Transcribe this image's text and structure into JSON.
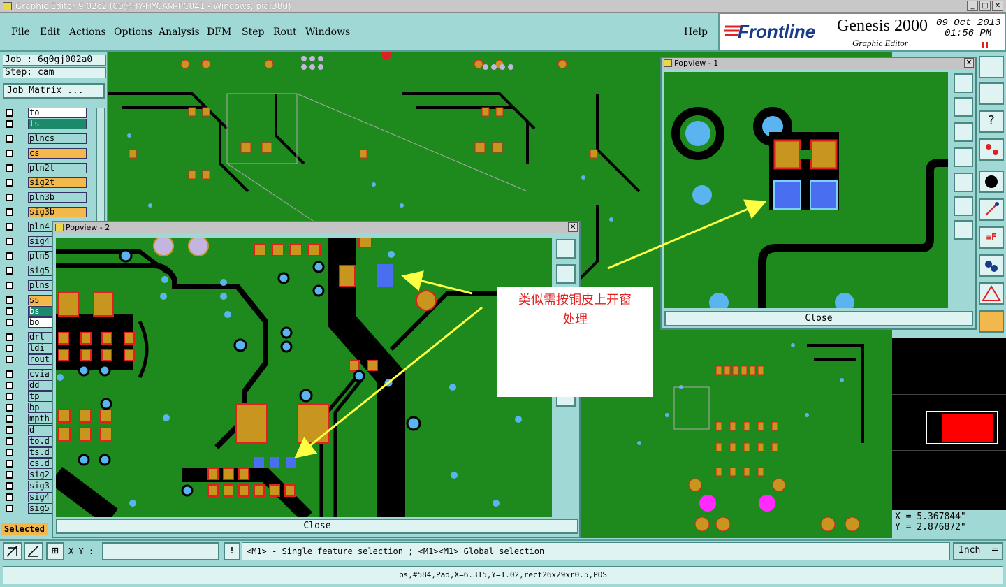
{
  "window": {
    "title": "Graphic Editor 9.02c2 (00@HY-HYCAM-PC041 - Windows, pid:380)"
  },
  "menu": [
    "File",
    "Edit",
    "Actions",
    "Options",
    "Analysis",
    "DFM",
    "Step",
    "Rout",
    "Windows"
  ],
  "help_label": "Help",
  "brand": {
    "logo": "Frontline",
    "product": "Genesis 2000",
    "subtitle": "Graphic Editor",
    "date": "09 Oct 2013",
    "time": "01:56 PM"
  },
  "job": {
    "job_line": "Job : 6g0gj002a0",
    "step_line": "Step: cam",
    "matrix_button": "Job Matrix ..."
  },
  "layers": [
    {
      "name": "to",
      "color": "#ffffff"
    },
    {
      "name": "ts",
      "color": "#1a8a6a"
    },
    {
      "name": "plncs",
      "color": "#9fd8d4"
    },
    {
      "name": "cs",
      "color": "#f2b84b"
    },
    {
      "name": "pln2t",
      "color": "#9fd8d4"
    },
    {
      "name": "sig2t",
      "color": "#f2b84b"
    },
    {
      "name": "pln3b",
      "color": "#9fd8d4"
    },
    {
      "name": "sig3b",
      "color": "#f2b84b"
    },
    {
      "name": "pln4",
      "color": "#9fd8d4"
    },
    {
      "name": "sig4",
      "color": "#9fd8d4"
    },
    {
      "name": "pln5",
      "color": "#9fd8d4"
    },
    {
      "name": "sig5",
      "color": "#9fd8d4"
    },
    {
      "name": "plns",
      "color": "#9fd8d4"
    },
    {
      "name": "ss",
      "color": "#f2b84b"
    },
    {
      "name": "bs",
      "color": "#1a8a6a"
    },
    {
      "name": "bo",
      "color": "#ffffff"
    },
    {
      "name": "drl",
      "color": "#9fd8d4"
    },
    {
      "name": "ldi",
      "color": "#9fd8d4"
    },
    {
      "name": "rout",
      "color": "#9fd8d4"
    },
    {
      "name": "cvia",
      "color": "#9fd8d4"
    },
    {
      "name": "dd",
      "color": "#9fd8d4"
    },
    {
      "name": "tp",
      "color": "#9fd8d4"
    },
    {
      "name": "bp",
      "color": "#9fd8d4"
    },
    {
      "name": "mpth",
      "color": "#9fd8d4"
    },
    {
      "name": "d",
      "color": "#9fd8d4"
    },
    {
      "name": "to.d",
      "color": "#9fd8d4"
    },
    {
      "name": "ts.d",
      "color": "#9fd8d4"
    },
    {
      "name": "cs.d",
      "color": "#9fd8d4"
    },
    {
      "name": "sig2",
      "color": "#9fd8d4"
    },
    {
      "name": "sig3",
      "color": "#9fd8d4"
    },
    {
      "name": "sig4",
      "color": "#9fd8d4"
    },
    {
      "name": "sig5",
      "color": "#9fd8d4"
    }
  ],
  "selected_label": "Selected",
  "popview1": {
    "title": "Popview - 1",
    "close_label": "Close",
    "close_x": "✕"
  },
  "popview2": {
    "title": "Popview - 2",
    "close_label": "Close",
    "close_x": "✕"
  },
  "annotation": {
    "line1": "类似需按铜皮上开窗",
    "line2": "处理"
  },
  "coords": {
    "x": "X = 5.367844\"",
    "y": "Y = 2.876872\""
  },
  "xy_label": "X Y :",
  "xy_value": "",
  "hint": "<M1> - Single feature selection ; <M1><M1> Global selection",
  "units": "Inch",
  "feature_info": "bs,#584,Pad,X=6.315,Y=1.02,rect26x29xr0.5,POS",
  "colors": {
    "board": "#1e8a1e",
    "copper": "#c8961e",
    "pad_edge": "#e02020",
    "via": "#5ab4f0",
    "void": "#000000",
    "selected": "#4a6ef0",
    "arrow": "#ffff44",
    "annot_text": "#e02020"
  }
}
